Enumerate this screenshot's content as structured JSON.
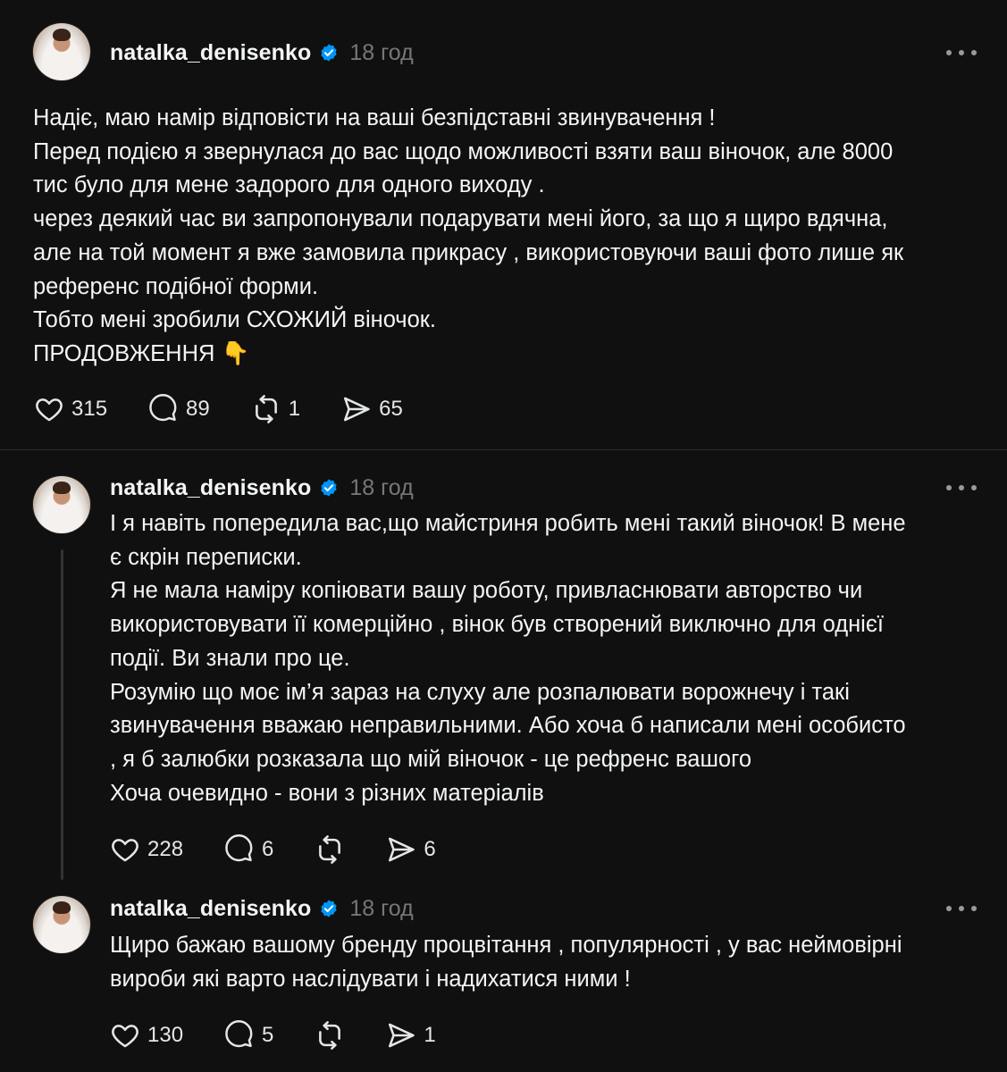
{
  "posts": [
    {
      "username": "natalka_denisenko",
      "time": "18 год",
      "lines": [
        "Надіє, маю намір відповісти на ваші безпідставні звинувачення !",
        "Перед подією я звернулася до вас щодо можливості взяти ваш віночок, але 8000",
        "тис було для мене задорого для одного виходу .",
        "через деякий час ви запропонували подарувати мені його, за що я щиро вдячна,",
        "але на той момент я вже замовила прикрасу , використовуючи ваші фото лише як",
        "референс подібної форми.",
        "Тобто мені зробили СХОЖИЙ віночок.",
        "ПРОДОВЖЕННЯ 👇"
      ],
      "likes": "315",
      "replies": "89",
      "reposts": "1",
      "shares": "65"
    },
    {
      "username": "natalka_denisenko",
      "time": "18 год",
      "lines": [
        "І я навіть попередила вас,що майстриня робить мені такий віночок! В мене",
        "є скрін переписки.",
        "Я не мала наміру копіювати вашу роботу, привласнювати авторство чи",
        "використовувати її комерційно , вінок був створений виключно для однієї",
        "події. Ви знали про це.",
        "Розумію що моє ім’я зараз на слуху але розпалювати ворожнечу і такі",
        "звинувачення вважаю неправильними. Або хоча б написали мені особисто",
        ", я б залюбки розказала що мій віночок - це рефренс вашого",
        "Хоча очевидно - вони з різних матеріалів"
      ],
      "likes": "228",
      "replies": "6",
      "reposts": "",
      "shares": "6"
    },
    {
      "username": "natalka_denisenko",
      "time": "18 год",
      "lines": [
        "Щиро бажаю вашому бренду процвітання , популярності , у вас неймовірні",
        "вироби які варто наслідувати і надихатися ними !"
      ],
      "likes": "130",
      "replies": "5",
      "reposts": "",
      "shares": "1"
    }
  ],
  "icons": {
    "like": "heart-icon",
    "reply": "comment-bubble-icon",
    "repost": "repost-icon",
    "share": "send-icon",
    "verified": "verified-badge-icon",
    "more": "more-options-icon"
  },
  "colors": {
    "background": "#101010",
    "text": "#f3f5f7",
    "muted": "#777777",
    "verified": "#0095f6"
  }
}
